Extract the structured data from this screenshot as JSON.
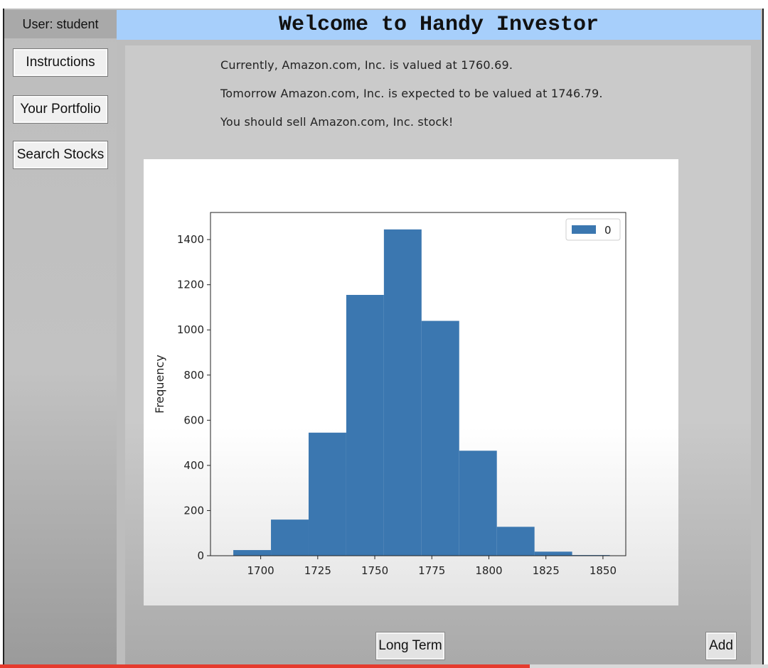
{
  "sidebar": {
    "user_label": "User: student",
    "buttons": [
      {
        "label": "Instructions"
      },
      {
        "label": "Your Portfolio"
      },
      {
        "label": "Search Stocks"
      }
    ]
  },
  "header": {
    "title": "Welcome to Handy Investor"
  },
  "main": {
    "messages": [
      "Currently, Amazon.com, Inc. is valued at 1760.69.",
      "Tomorrow Amazon.com, Inc. is expected to be valued at 1746.79.",
      "You should sell Amazon.com, Inc. stock!"
    ],
    "long_term_button": "Long Term",
    "add_button": "Add"
  },
  "video": {
    "progress": 0.69
  },
  "colors": {
    "bar": "#3b77b0",
    "header_bg": "#a7cffb",
    "progress": "#e63b2e"
  },
  "chart_data": {
    "type": "bar",
    "title": "",
    "xlabel": "",
    "ylabel": "Frequency",
    "legend": [
      "0"
    ],
    "legend_position": "top-right",
    "grid": false,
    "bins": [
      {
        "x0": 1688,
        "x1": 1704.5,
        "value": 25
      },
      {
        "x0": 1704.5,
        "x1": 1721,
        "value": 160
      },
      {
        "x0": 1721,
        "x1": 1737.5,
        "value": 545
      },
      {
        "x0": 1737.5,
        "x1": 1754,
        "value": 1155
      },
      {
        "x0": 1754,
        "x1": 1770.5,
        "value": 1445
      },
      {
        "x0": 1770.5,
        "x1": 1787,
        "value": 1040
      },
      {
        "x0": 1787,
        "x1": 1803.5,
        "value": 465
      },
      {
        "x0": 1803.5,
        "x1": 1820,
        "value": 128
      },
      {
        "x0": 1820,
        "x1": 1836.5,
        "value": 18
      },
      {
        "x0": 1836.5,
        "x1": 1853,
        "value": 3
      }
    ],
    "xticks": [
      1700,
      1725,
      1750,
      1775,
      1800,
      1825,
      1850
    ],
    "yticks": [
      0,
      200,
      400,
      600,
      800,
      1000,
      1200,
      1400
    ],
    "xlim": [
      1678,
      1860
    ],
    "ylim": [
      0,
      1520
    ]
  }
}
